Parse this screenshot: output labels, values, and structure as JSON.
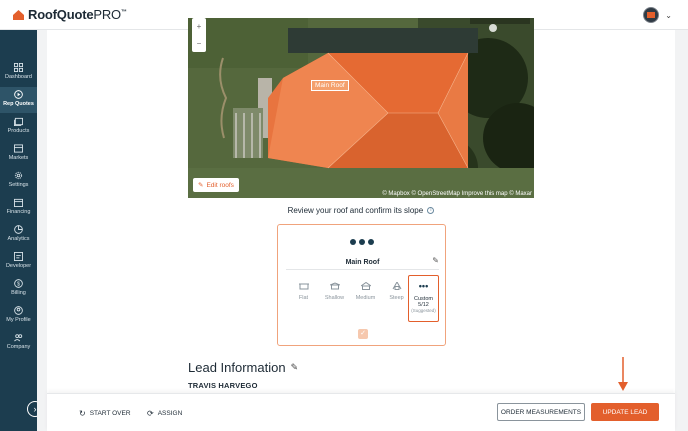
{
  "brand": {
    "name": "RoofQuote",
    "suffix": "PRO",
    "tm": "™",
    "accent": "#e35f2c",
    "navy": "#1c3d4f"
  },
  "sidebar": {
    "items": [
      {
        "label": "Dashboard",
        "icon": "grid-icon"
      },
      {
        "label": "Rep Quotes",
        "icon": "play-circle-icon",
        "active": true
      },
      {
        "label": "Products",
        "icon": "gallery-icon"
      },
      {
        "label": "Markets",
        "icon": "store-icon"
      },
      {
        "label": "Settings",
        "icon": "gear-icon"
      },
      {
        "label": "Financing",
        "icon": "calendar-icon"
      },
      {
        "label": "Analytics",
        "icon": "pie-chart-icon"
      },
      {
        "label": "Developer",
        "icon": "code-icon"
      },
      {
        "label": "Billing",
        "icon": "dollar-icon"
      },
      {
        "label": "My Profile",
        "icon": "user-circle-icon"
      },
      {
        "label": "Company",
        "icon": "people-icon"
      }
    ],
    "collapse_icon": "chevron-right-icon"
  },
  "map": {
    "roof_tag": "Main Roof",
    "edit_label": "Edit roofs",
    "attribution": "© Mapbox © OpenStreetMap Improve this map © Maxar",
    "zoom_in": "+",
    "zoom_out": "−"
  },
  "review": {
    "text": "Review your roof and confirm its slope",
    "info": "i"
  },
  "slope_card": {
    "roof_name": "Main Roof",
    "options": [
      {
        "label": "Flat",
        "icon": "flat-roof-icon"
      },
      {
        "label": "Shallow",
        "icon": "shallow-roof-icon"
      },
      {
        "label": "Medium",
        "icon": "medium-roof-icon"
      },
      {
        "label": "Steep",
        "icon": "steep-roof-icon"
      },
      {
        "label": "Custom",
        "value": "5/12",
        "note": "(Suggested)",
        "icon": "more-dots-icon",
        "selected": true
      }
    ],
    "confirm_icon": "check-icon"
  },
  "lead": {
    "title": "Lead Information",
    "name": "TRAVIS HARVEGO"
  },
  "footer": {
    "start_over": "START OVER",
    "assign": "ASSIGN",
    "order": "ORDER MEASUREMENTS",
    "update": "UPDATE LEAD"
  }
}
